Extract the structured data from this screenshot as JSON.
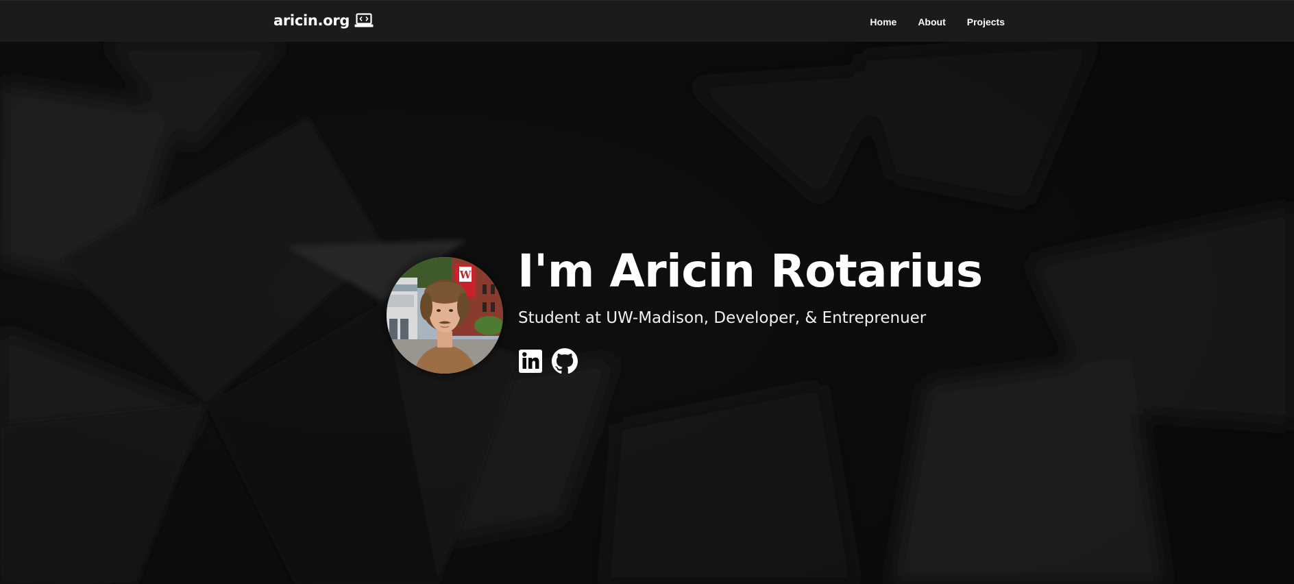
{
  "navbar": {
    "brand": "aricin.org",
    "brand_icon": "laptop-code-icon",
    "links": [
      {
        "label": "Home"
      },
      {
        "label": "About"
      },
      {
        "label": "Projects"
      }
    ]
  },
  "hero": {
    "headline": "I'm Aricin Rotarius",
    "subtitle": "Student at UW-Madison, Developer, & Entreprenuer",
    "avatar_alt": "profile-photo",
    "socials": [
      {
        "icon": "linkedin-icon"
      },
      {
        "icon": "github-icon"
      }
    ]
  },
  "colors": {
    "background": "#0a0a0a",
    "navbar": "#1c1b1b",
    "text": "#ffffff"
  }
}
